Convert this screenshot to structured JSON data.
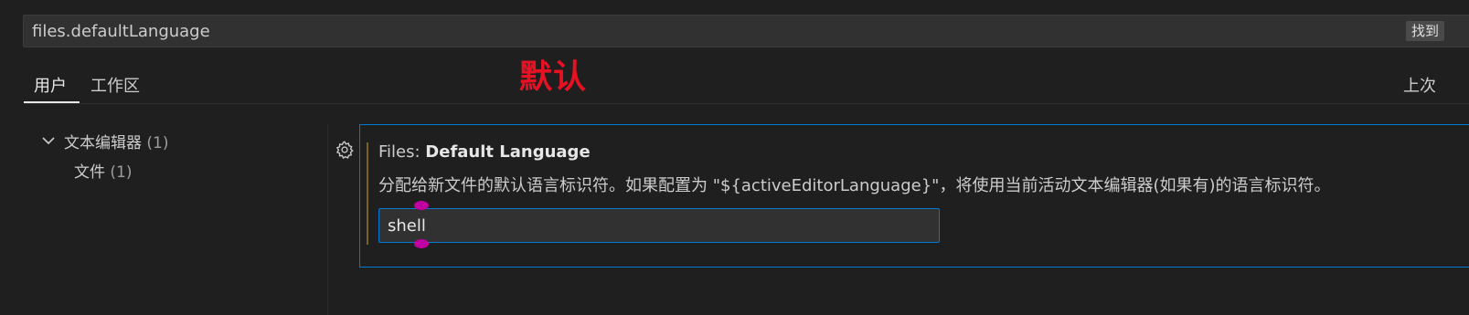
{
  "search": {
    "value": "files.defaultLanguage",
    "badge_label": "找到"
  },
  "tabs": {
    "user_label": "用户",
    "workspace_label": "工作区",
    "right_label": "上次"
  },
  "annotation": {
    "text": "默认",
    "color": "#e81123"
  },
  "tree": {
    "items": [
      {
        "label": "文本编辑器",
        "count": "(1)"
      },
      {
        "label": "文件",
        "count": "(1)"
      }
    ]
  },
  "setting": {
    "category": "Files: ",
    "name": "Default Language",
    "description": "分配给新文件的默认语言标识符。如果配置为 \"${activeEditorLanguage}\"，将使用当前活动文本编辑器(如果有)的语言标识符。",
    "value": "shell"
  },
  "colors": {
    "accent": "#0078d4",
    "modified_indicator": "#7a6226",
    "cursor_handle": "#c000a0"
  },
  "icons": {
    "tree_toggle": "chevron-down-icon",
    "setting_menu": "gear-icon"
  }
}
